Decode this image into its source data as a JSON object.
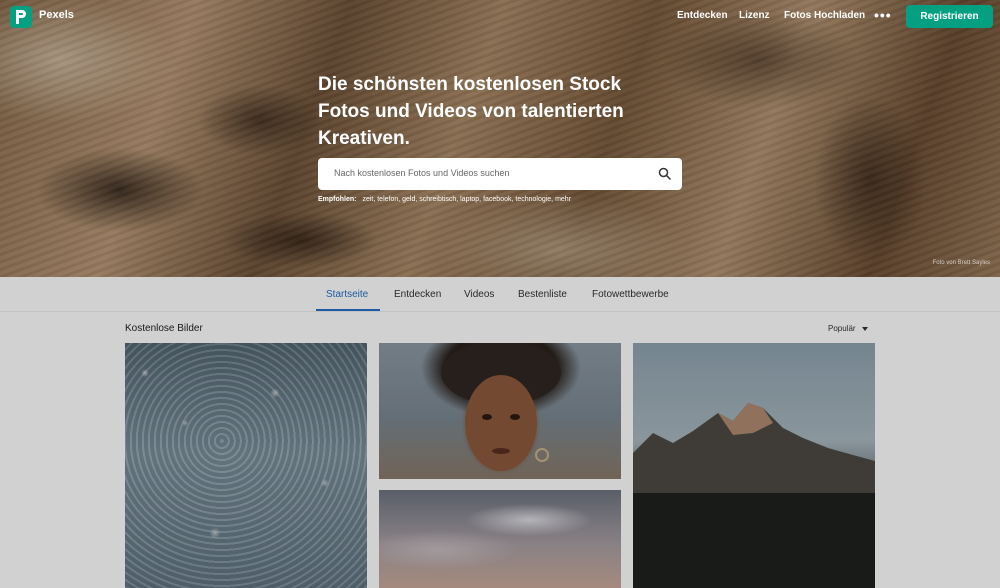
{
  "header": {
    "brand": "Pexels",
    "nav": [
      "Entdecken",
      "Lizenz",
      "Fotos Hochladen"
    ],
    "more": "•••",
    "register_label": "Registrieren"
  },
  "hero": {
    "title": "Die schönsten kostenlosen Stock Fotos und Videos von talentierten Kreativen.",
    "search_placeholder": "Nach kostenlosen Fotos und Videos suchen",
    "suggest_label": "Empfohlen:",
    "suggestions": "zeit, telefon, geld, schreibtisch, laptop, facebook, technologie, mehr",
    "credit": "Foto von Brett Sayles"
  },
  "tabs": [
    "Startseite",
    "Entdecken",
    "Videos",
    "Bestenliste",
    "Fotowettbewerbe"
  ],
  "active_tab": "Startseite",
  "gallery": {
    "title": "Kostenlose Bilder",
    "sort_label": "Populär"
  },
  "colors": {
    "accent": "#05a081",
    "tab_active": "#2570c8"
  },
  "icons": [
    "pexels-logo-icon",
    "search-icon",
    "chevron-down-icon"
  ]
}
